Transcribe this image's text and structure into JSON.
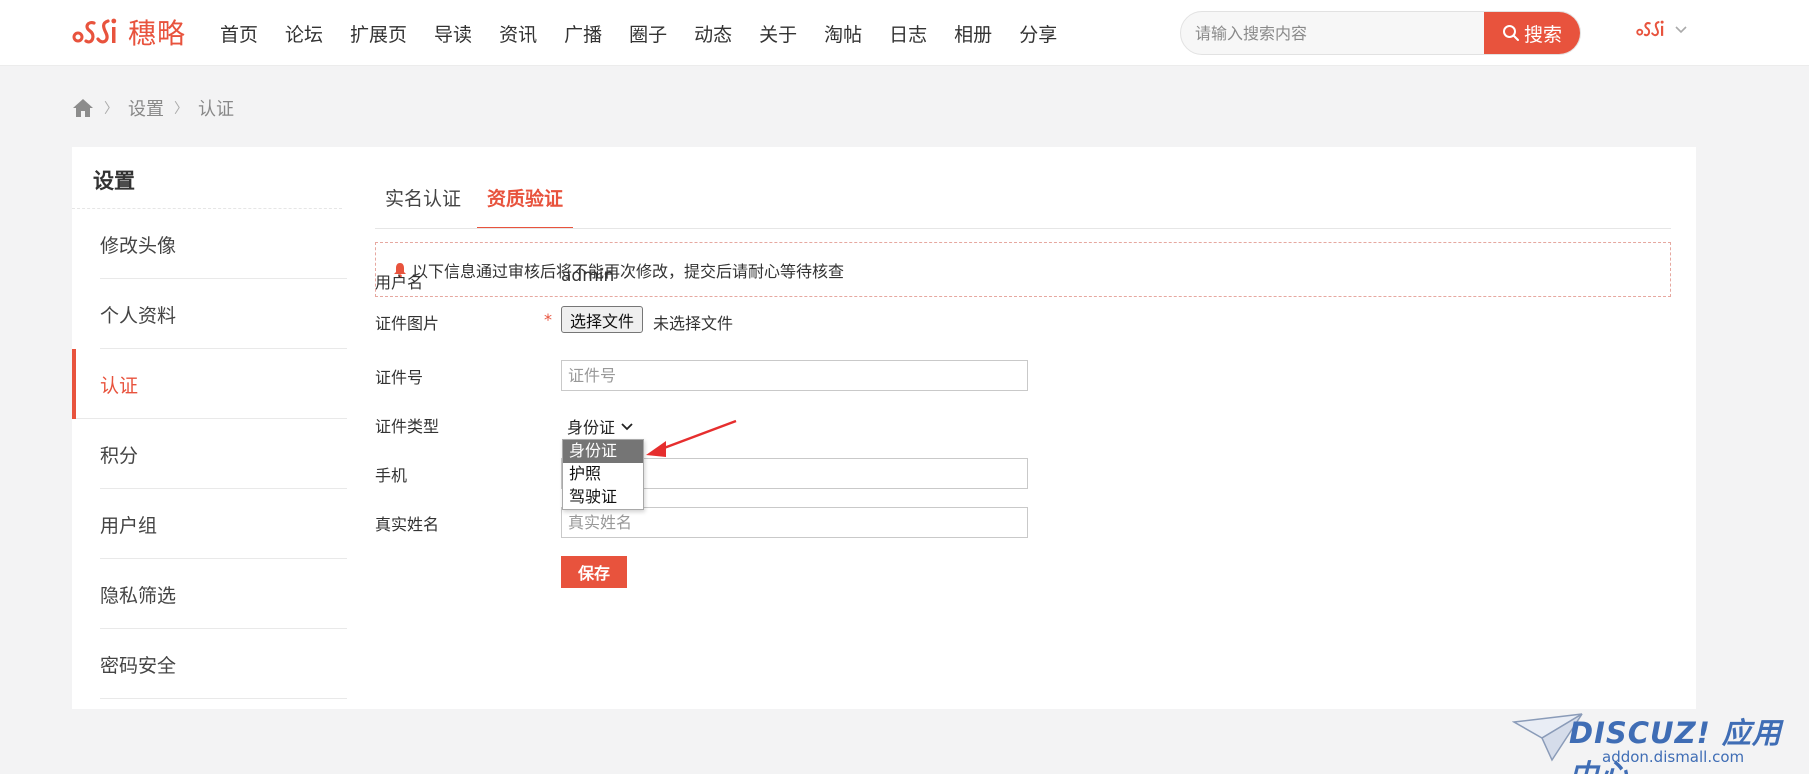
{
  "header": {
    "brand": "穗略",
    "nav": [
      "首页",
      "论坛",
      "扩展页",
      "导读",
      "资讯",
      "广播",
      "圈子",
      "动态",
      "关于",
      "淘帖",
      "日志",
      "相册",
      "分享"
    ],
    "search_placeholder": "请输入搜索内容",
    "search_button": "搜索"
  },
  "breadcrumb": [
    "设置",
    "认证"
  ],
  "sidebar": {
    "title": "设置",
    "items": [
      "修改头像",
      "个人资料",
      "认证",
      "积分",
      "用户组",
      "隐私筛选",
      "密码安全"
    ],
    "active_index": 2
  },
  "tabs": [
    "实名认证",
    "资质验证"
  ],
  "notice": "以下信息通过审核后将不能再次修改，提交后请耐心等待核查",
  "form": {
    "username_label": "用户名",
    "username_value": "admin",
    "cert_image_label": "证件图片",
    "required_mark": "*",
    "file_button": "选择文件",
    "file_status": "未选择文件",
    "cert_number_label": "证件号",
    "cert_number_placeholder": "证件号",
    "cert_type_label": "证件类型",
    "cert_type_selected": "身份证",
    "cert_type_options": [
      "身份证",
      "护照",
      "驾驶证"
    ],
    "phone_label": "手机",
    "real_name_label": "真实姓名",
    "real_name_placeholder": "真实姓名",
    "save_button": "保存"
  },
  "watermark": {
    "brand": "DISCUZ! 应用中心",
    "url": "addon.dismall.com"
  },
  "colors": {
    "accent": "#e8533d",
    "page_bg": "#f3f3f4",
    "watermark": "#3f6db5"
  }
}
